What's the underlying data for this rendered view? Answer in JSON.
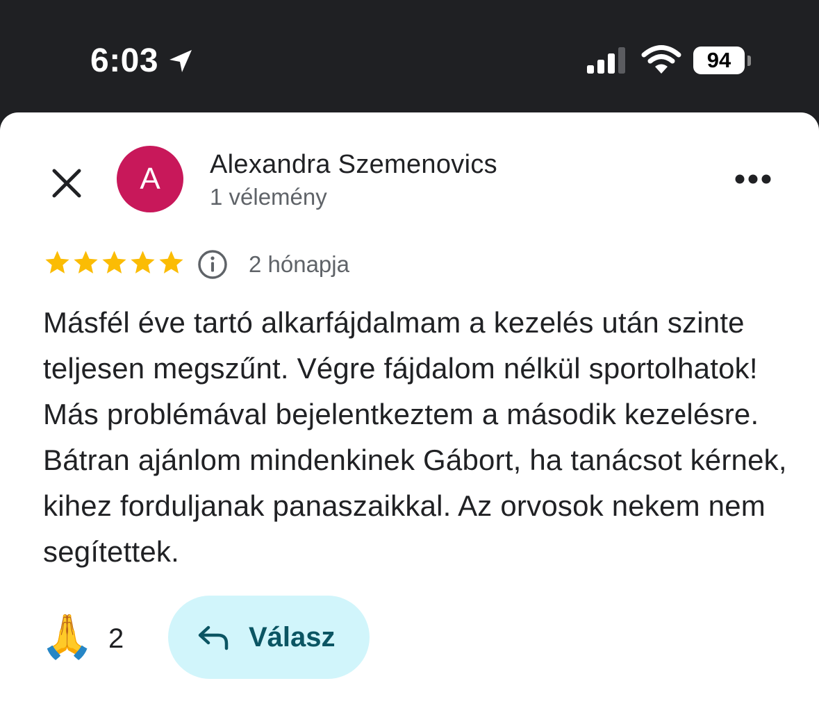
{
  "status_bar": {
    "time": "6:03",
    "battery_level": "94",
    "icons": [
      "location-arrow-icon",
      "cellular-signal-icon",
      "wifi-icon",
      "battery-icon"
    ]
  },
  "review": {
    "author": {
      "avatar_letter": "A",
      "avatar_color": "#c8185a",
      "name": "Alexandra Szemenovics",
      "subtitle": "1 vélemény"
    },
    "rating": 5,
    "star_color": "#fbbc04",
    "date": "2 hónapja",
    "text": "Másfél éve tartó alkarfájdalmam a kezelés után szinte teljesen megszűnt. Végre fájdalom nélkül sportolhatok! Más problémával bejelentkeztem a második kezelésre. Bátran ajánlom mindenkinek Gábort, ha tanácsot kérnek, kihez forduljanak panaszaikkal. Az orvosok nekem nem segítettek.",
    "reaction": {
      "emoji": "🙏",
      "count": "2"
    },
    "reply_button": {
      "label": "Válasz",
      "background": "#d1f5fb",
      "text_color": "#0b5563"
    }
  }
}
